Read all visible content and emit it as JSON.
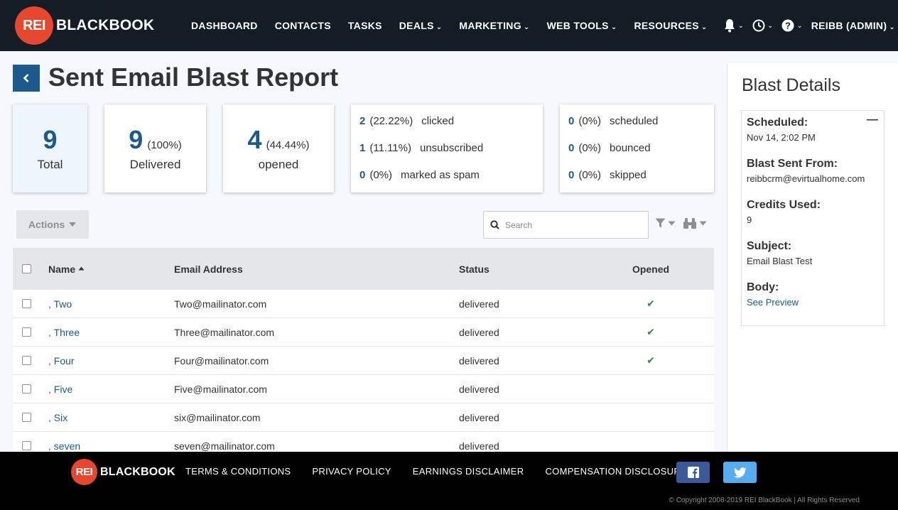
{
  "brand": {
    "badge": "REI",
    "word": "BLACKBOOK"
  },
  "nav": {
    "items": [
      {
        "label": "DASHBOARD",
        "dropdown": false
      },
      {
        "label": "CONTACTS",
        "dropdown": false
      },
      {
        "label": "TASKS",
        "dropdown": false
      },
      {
        "label": "DEALS",
        "dropdown": true
      },
      {
        "label": "MARKETING",
        "dropdown": true
      },
      {
        "label": "WEB TOOLS",
        "dropdown": true
      },
      {
        "label": "RESOURCES",
        "dropdown": true
      }
    ],
    "user": "REIBB (ADMIN)",
    "icons": [
      "bell-icon",
      "clock-icon",
      "help-icon"
    ]
  },
  "page": {
    "title": "Sent Email Blast Report",
    "back_icon": "chevron-left-icon"
  },
  "summary": {
    "total": {
      "value": "9",
      "label": "Total"
    },
    "delivered": {
      "value": "9",
      "pct": "(100%)",
      "label": "Delivered"
    },
    "opened": {
      "value": "4",
      "pct": "(44.44%)",
      "label": "opened"
    },
    "engagement": [
      {
        "value": "2",
        "pct": "(22.22%)",
        "label": "clicked"
      },
      {
        "value": "1",
        "pct": "(11.11%)",
        "label": "unsubscribed"
      },
      {
        "value": "0",
        "pct": "(0%)",
        "label": "marked as spam"
      }
    ],
    "issues": [
      {
        "value": "0",
        "pct": "(0%)",
        "label": "scheduled"
      },
      {
        "value": "0",
        "pct": "(0%)",
        "label": "bounced"
      },
      {
        "value": "0",
        "pct": "(0%)",
        "label": "skipped"
      }
    ]
  },
  "toolbar": {
    "actions_label": "Actions",
    "search_placeholder": "Search",
    "filter_icon": "filter-icon",
    "binoculars_icon": "binoculars-icon"
  },
  "table": {
    "headers": {
      "name": "Name",
      "email": "Email Address",
      "status": "Status",
      "opened": "Opened"
    },
    "sort_icon": "sort-asc-icon",
    "rows": [
      {
        "name": ", Two",
        "email": "Two@mailinator.com",
        "status": "delivered",
        "opened": true
      },
      {
        "name": ", Three",
        "email": "Three@mailinator.com",
        "status": "delivered",
        "opened": true
      },
      {
        "name": ", Four",
        "email": "Four@mailinator.com",
        "status": "delivered",
        "opened": true
      },
      {
        "name": ", Five",
        "email": "Five@mailinator.com",
        "status": "delivered",
        "opened": false
      },
      {
        "name": ", Six",
        "email": "six@mailinator.com",
        "status": "delivered",
        "opened": false
      },
      {
        "name": ", seven",
        "email": "seven@mailinator.com",
        "status": "delivered",
        "opened": false
      }
    ]
  },
  "blast_details": {
    "title": "Blast Details",
    "scheduled_label": "Scheduled:",
    "scheduled_value": "Nov 14, 2:02 PM",
    "sent_from_label": "Blast Sent From:",
    "sent_from_value": "reibbcrm@evirtualhome.com",
    "credits_label": "Credits Used:",
    "credits_value": "9",
    "subject_label": "Subject:",
    "subject_value": "Email Blast Test",
    "body_label": "Body:",
    "body_link": "See Preview"
  },
  "footer": {
    "links": [
      "TERMS & CONDITIONS",
      "PRIVACY POLICY",
      "EARNINGS DISCLAIMER",
      "COMPENSATION DISCLOSURE"
    ],
    "social": [
      "facebook-icon",
      "twitter-icon"
    ],
    "copyright": "© Copyright 2008-2019 REI BlackBook | All Rights Reserved"
  },
  "colors": {
    "nav_bg": "#141c26",
    "brand_red": "#e8472f",
    "accent_blue": "#1c5a8c",
    "check_green": "#2e8b3a",
    "facebook": "#3b5998",
    "twitter": "#55acee"
  }
}
